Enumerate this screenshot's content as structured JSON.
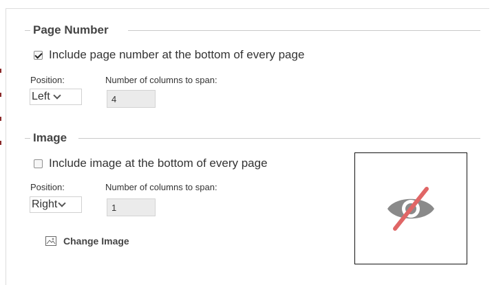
{
  "page_number_section": {
    "title": "Page Number",
    "include_label": "Include page number at the bottom of every page",
    "include_checked": true,
    "position_label": "Position:",
    "position_value": "Left",
    "columns_label": "Number of columns to span:",
    "columns_value": "4"
  },
  "image_section": {
    "title": "Image",
    "include_label": "Include image at the bottom of every page",
    "include_checked": false,
    "position_label": "Position:",
    "position_value": "Right",
    "columns_label": "Number of columns to span:",
    "columns_value": "1",
    "change_image_label": "Change Image",
    "change_image_icon": "image-icon",
    "preview_icon": "eye-slash-icon"
  },
  "colors": {
    "preview_eye": "#8a8a8a",
    "preview_slash": "#e06666",
    "left_marks": "#8b2a2a"
  }
}
